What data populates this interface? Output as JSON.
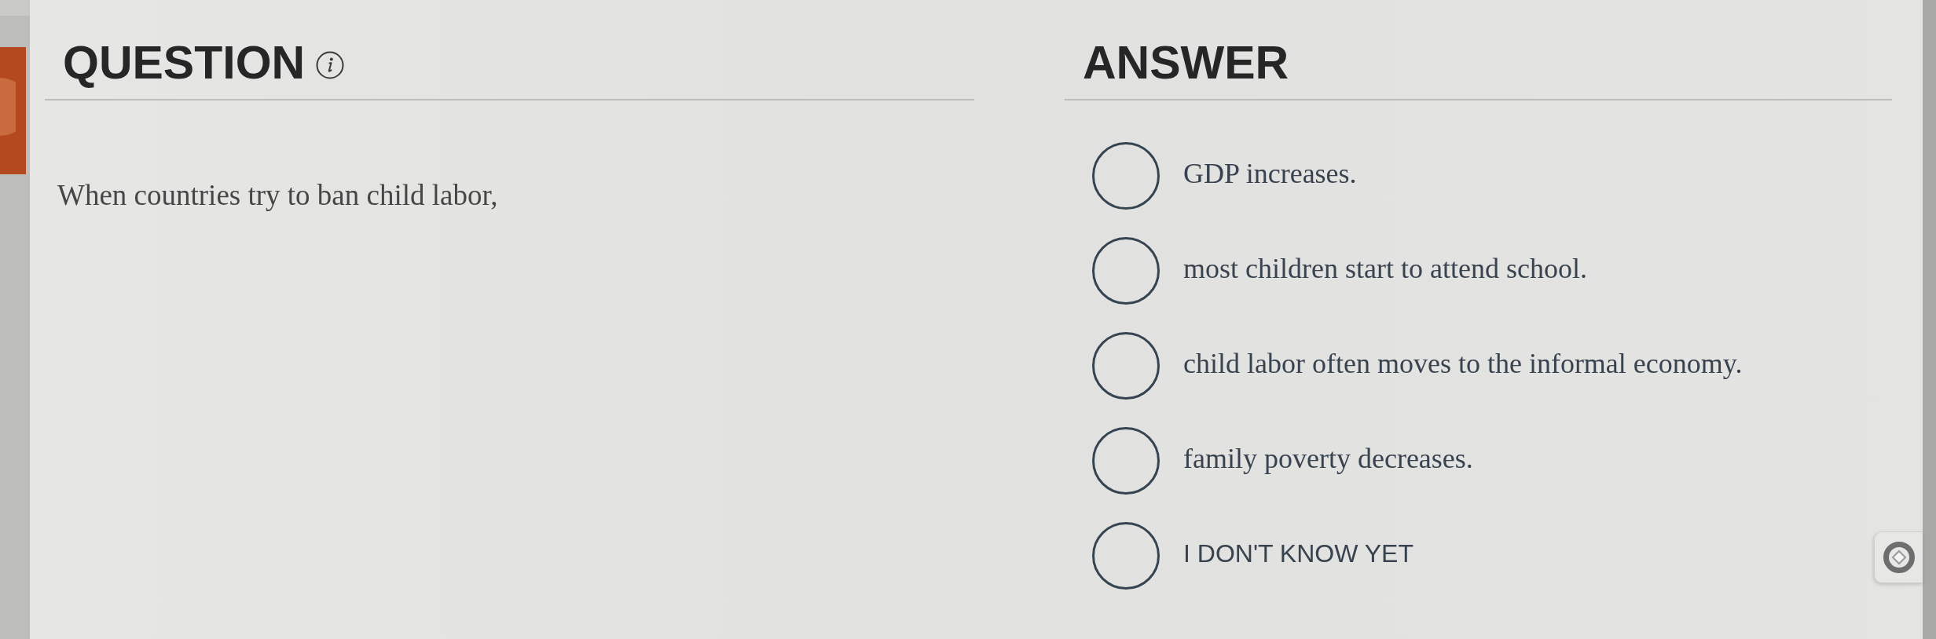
{
  "question": {
    "heading": "QUESTION",
    "text": "When countries try to ban child labor,"
  },
  "answer": {
    "heading": "ANSWER",
    "options": [
      {
        "kind": "statement",
        "label": "GDP increases.",
        "selected": false
      },
      {
        "kind": "statement",
        "label": "most children start to attend school.",
        "selected": false
      },
      {
        "kind": "statement",
        "label": "child labor often moves to the informal economy.",
        "selected": false
      },
      {
        "kind": "statement",
        "label": "family poverty decreases.",
        "selected": false
      },
      {
        "kind": "unsure",
        "label": "I DON'T KNOW YET",
        "selected": false
      }
    ]
  }
}
